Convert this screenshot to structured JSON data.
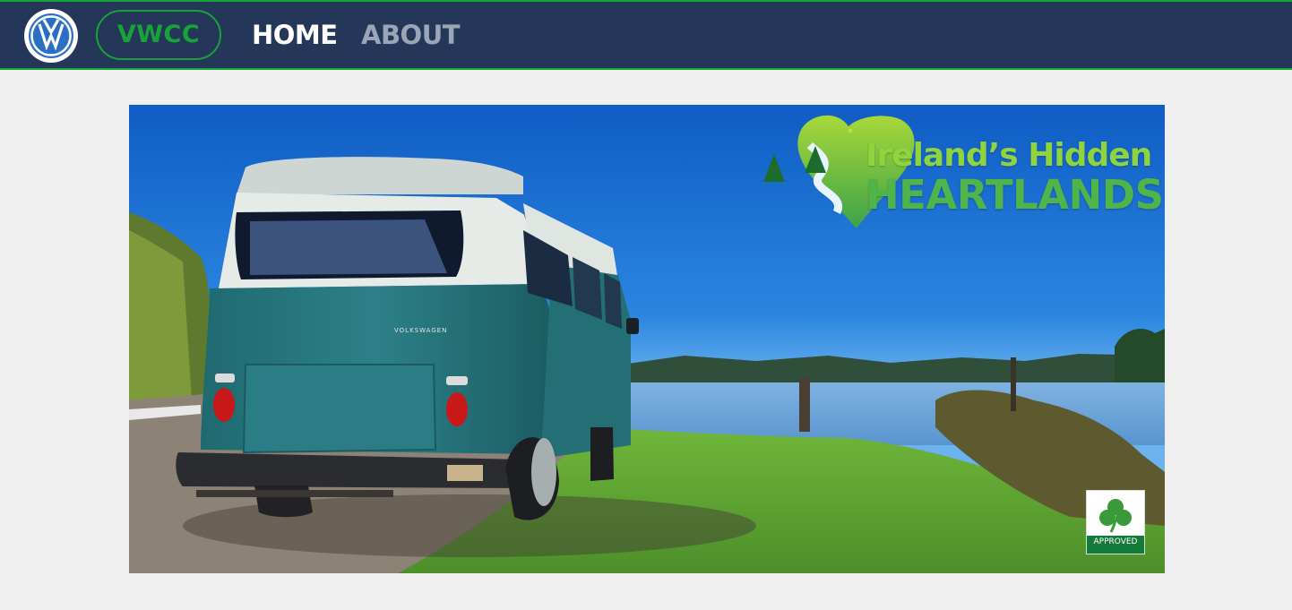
{
  "navbar": {
    "logo_icon": "volkswagen-logo-icon",
    "brand_label": "VWCC",
    "links": [
      {
        "label": "HOME",
        "active": true
      },
      {
        "label": "ABOUT",
        "active": false
      }
    ]
  },
  "hero": {
    "logo_icon": "heart-river-icon",
    "title_line_1": "Ireland’s Hidden",
    "title_line_2": "HEARTLANDS",
    "van_badge_text": "VOLKSWAGEN",
    "approved_badge": {
      "icon": "shamrock-icon",
      "label": "APPROVED"
    }
  },
  "colors": {
    "nav_background": "#253758",
    "accent_green": "#18a33a",
    "page_background": "#efefef",
    "inactive_link": "#9aa5b8"
  }
}
